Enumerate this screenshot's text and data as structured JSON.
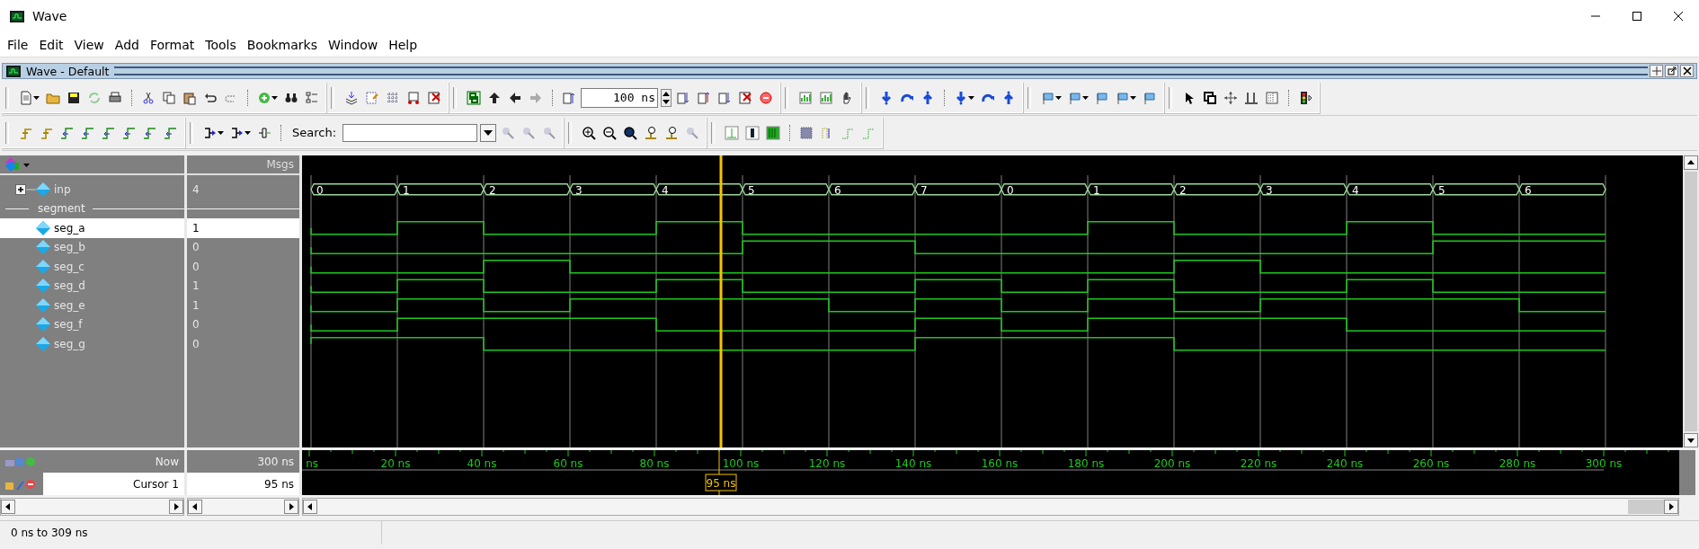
{
  "window": {
    "title": "Wave"
  },
  "menu": [
    "File",
    "Edit",
    "View",
    "Add",
    "Format",
    "Tools",
    "Bookmarks",
    "Window",
    "Help"
  ],
  "dock": {
    "title": "Wave - Default"
  },
  "toolbar": {
    "run_length": "100 ns",
    "search_label": "Search:"
  },
  "wave": {
    "header": {
      "column_2": "Msgs"
    },
    "signals": [
      {
        "kind": "bus",
        "name": "inp",
        "value": "4",
        "expanded": false,
        "selected": false
      },
      {
        "kind": "divider",
        "name": "segment"
      },
      {
        "kind": "bit",
        "name": "seg_a",
        "value": "1",
        "selected": true
      },
      {
        "kind": "bit",
        "name": "seg_b",
        "value": "0",
        "selected": false
      },
      {
        "kind": "bit",
        "name": "seg_c",
        "value": "0",
        "selected": false
      },
      {
        "kind": "bit",
        "name": "seg_d",
        "value": "1",
        "selected": false
      },
      {
        "kind": "bit",
        "name": "seg_e",
        "value": "1",
        "selected": false
      },
      {
        "kind": "bit",
        "name": "seg_f",
        "value": "0",
        "selected": false
      },
      {
        "kind": "bit",
        "name": "seg_g",
        "value": "0",
        "selected": false
      }
    ],
    "bus_values": [
      "0",
      "1",
      "2",
      "3",
      "4",
      "5",
      "6",
      "7",
      "0",
      "1",
      "2",
      "3",
      "4",
      "5",
      "6"
    ],
    "time_axis": [
      "ns",
      "20 ns",
      "40 ns",
      "60 ns",
      "80 ns",
      "100 ns",
      "120 ns",
      "140 ns",
      "160 ns",
      "180 ns",
      "200 ns",
      "220 ns",
      "240 ns",
      "260 ns",
      "280 ns",
      "300 ns"
    ],
    "now": {
      "label": "Now",
      "value": "300 ns"
    },
    "cursor": {
      "label": "Cursor 1",
      "value": "95 ns",
      "marker": "95 ns"
    }
  },
  "status_bar": {
    "range": "0 ns to 309 ns"
  }
}
